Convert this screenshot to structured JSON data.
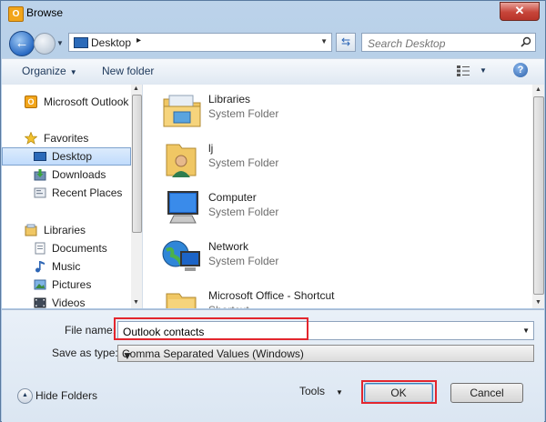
{
  "window": {
    "title": "Browse",
    "close_label": "✕"
  },
  "navbar": {
    "address_location": "Desktop",
    "address_separator": "▸",
    "search_placeholder": "Search Desktop"
  },
  "toolbar": {
    "organize_label": "Organize",
    "new_folder_label": "New folder",
    "help_label": "?"
  },
  "sidebar": {
    "items": [
      {
        "label": "Microsoft Outlook",
        "icon": "outlook-icon"
      },
      {
        "label": "Favorites",
        "icon": "star-icon"
      },
      {
        "label": "Desktop",
        "icon": "desktop-icon",
        "selected": true
      },
      {
        "label": "Downloads",
        "icon": "downloads-icon"
      },
      {
        "label": "Recent Places",
        "icon": "recent-places-icon"
      },
      {
        "label": "Libraries",
        "icon": "libraries-icon"
      },
      {
        "label": "Documents",
        "icon": "documents-icon"
      },
      {
        "label": "Music",
        "icon": "music-icon"
      },
      {
        "label": "Pictures",
        "icon": "pictures-icon"
      },
      {
        "label": "Videos",
        "icon": "videos-icon"
      }
    ]
  },
  "files": [
    {
      "name": "Libraries",
      "type": "System Folder",
      "icon": "libraries-folder-icon"
    },
    {
      "name": "lj",
      "type": "System Folder",
      "icon": "user-folder-icon"
    },
    {
      "name": "Computer",
      "type": "System Folder",
      "icon": "computer-icon"
    },
    {
      "name": "Network",
      "type": "System Folder",
      "icon": "network-icon"
    },
    {
      "name": "Microsoft Office - Shortcut",
      "type": "Shortcut",
      "icon": "shortcut-folder-icon"
    }
  ],
  "form": {
    "file_name_label": "File name:",
    "file_name_value": "Outlook contacts",
    "save_as_type_label": "Save as type:",
    "save_as_type_value": "Comma Separated Values (Windows)"
  },
  "footer": {
    "hide_folders_label": "Hide Folders",
    "tools_label": "Tools",
    "ok_label": "OK",
    "cancel_label": "Cancel"
  },
  "colors": {
    "highlight": "#e3262e",
    "accent": "#2a6bc4"
  }
}
